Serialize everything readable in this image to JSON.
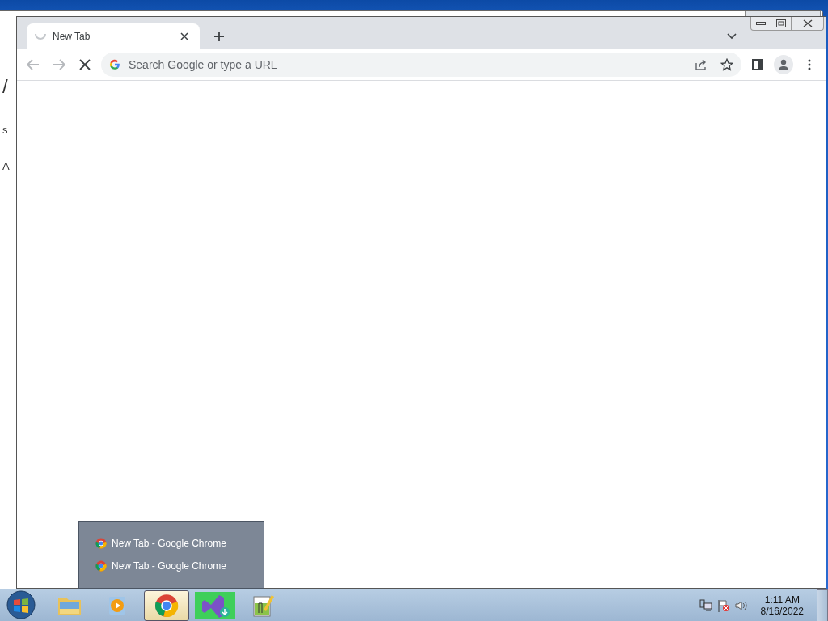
{
  "background_window": {
    "fragments": [
      "/",
      "s",
      "A"
    ]
  },
  "browser": {
    "tabs": [
      {
        "title": "New Tab",
        "selected": true,
        "loading": true
      }
    ],
    "omnibox": {
      "placeholder": "Search Google or type a URL"
    }
  },
  "jump_list": {
    "items": [
      {
        "label": "New Tab - Google Chrome"
      },
      {
        "label": "New Tab - Google Chrome"
      }
    ]
  },
  "taskbar": {
    "apps": [
      {
        "kind": "explorer",
        "active": false
      },
      {
        "kind": "media",
        "active": false
      },
      {
        "kind": "chrome",
        "active": true
      },
      {
        "kind": "studio",
        "active": false
      },
      {
        "kind": "notepad",
        "active": false
      }
    ],
    "clock": {
      "time": "1:11 AM",
      "date": "8/16/2022"
    }
  }
}
